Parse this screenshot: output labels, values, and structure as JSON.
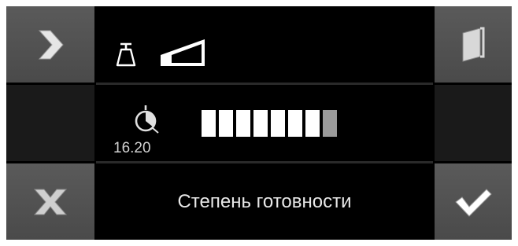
{
  "buttons": {
    "forward": {
      "icon": "chevron-right-icon"
    },
    "door": {
      "icon": "door-icon"
    },
    "cancel": {
      "icon": "x-icon"
    },
    "confirm": {
      "icon": "checkmark-icon"
    }
  },
  "top": {
    "icons": [
      "weight-icon",
      "ramp-icon"
    ]
  },
  "timer": {
    "icon": "timer-icon",
    "value": "16.20"
  },
  "progress": {
    "segments_total": 8,
    "segments_filled": 7,
    "last_segment_state": "partial",
    "colors": {
      "filled": "#ffffff",
      "partial": "#9a9a9a"
    }
  },
  "status": {
    "label": "Степень готовности"
  }
}
